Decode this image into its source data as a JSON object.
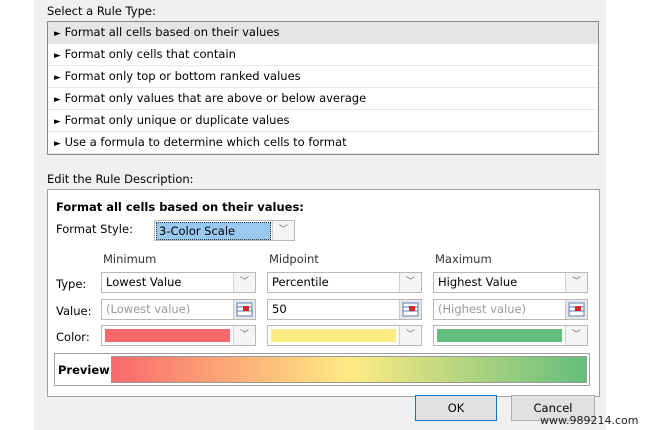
{
  "rule_type": {
    "label": "Select a Rule Type:",
    "items": [
      "Format all cells based on their values",
      "Format only cells that contain",
      "Format only top or bottom ranked values",
      "Format only values that are above or below average",
      "Format only unique or duplicate values",
      "Use a formula to determine which cells to format"
    ],
    "selected": 0
  },
  "description": {
    "label": "Edit the Rule Description:",
    "title": "Format all cells based on their values:",
    "format_style_label": "Format Style:",
    "format_style_value": "3-Color Scale",
    "row_labels": {
      "type": "Type:",
      "value": "Value:",
      "color": "Color:"
    },
    "columns": [
      {
        "header": "Minimum",
        "type": "Lowest Value",
        "value": "",
        "placeholder": "(Lowest value)",
        "color": "#f8696b"
      },
      {
        "header": "Midpoint",
        "type": "Percentile",
        "value": "50",
        "placeholder": "",
        "color": "#ffeb84"
      },
      {
        "header": "Maximum",
        "type": "Highest Value",
        "value": "",
        "placeholder": "(Highest value)",
        "color": "#63be7b"
      }
    ],
    "preview_label": "Preview:"
  },
  "buttons": {
    "ok": "OK",
    "cancel": "Cancel"
  },
  "watermark": "www.989214.com"
}
